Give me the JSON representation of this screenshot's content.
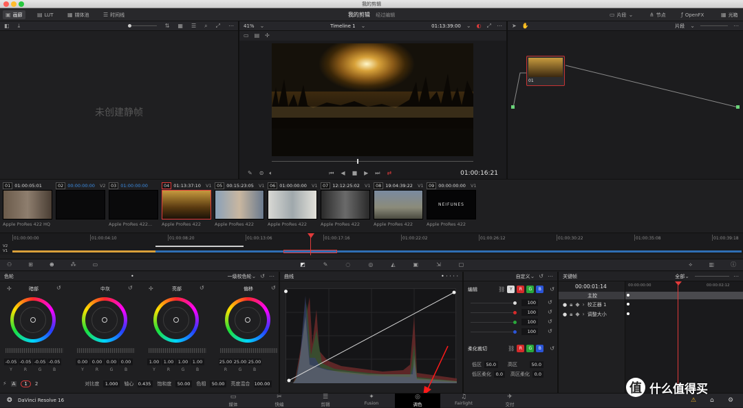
{
  "window": {
    "title": "我的剪辑"
  },
  "toolbar": {
    "gallery": "画廊",
    "lut": "LUT",
    "media_pool": "媒体池",
    "timeline": "时间线",
    "project": "我的剪辑",
    "project_sub": "经过编辑",
    "clips": "片段",
    "nodes": "节点",
    "openfx": "OpenFX",
    "lightbox": "光箱"
  },
  "viewer": {
    "zoom": "41%",
    "timeline_name": "Timeline 1",
    "timecode_top": "01:13:39:00",
    "timecode": "01:00:16:21",
    "clip_mode": "片段"
  },
  "gallery": {
    "empty_text": "未创建静帧"
  },
  "node": {
    "label": "01"
  },
  "clips": [
    {
      "num": "01",
      "tc": "01:00:05:01",
      "blue": false,
      "track": "",
      "fmt": "Apple ProRes 422 HQ",
      "selected": false
    },
    {
      "num": "02",
      "tc": "00:00:00:00",
      "blue": true,
      "track": "V2",
      "fmt": "",
      "selected": false
    },
    {
      "num": "03",
      "tc": "01:00:00:00",
      "blue": true,
      "track": "",
      "fmt": "Apple ProRes 422...",
      "selected": false
    },
    {
      "num": "04",
      "tc": "01:13:37:10",
      "blue": false,
      "track": "V1",
      "fmt": "Apple ProRes 422",
      "selected": true
    },
    {
      "num": "05",
      "tc": "00:15:23:05",
      "blue": false,
      "track": "V1",
      "fmt": "Apple ProRes 422",
      "selected": false
    },
    {
      "num": "06",
      "tc": "01:00:00:00",
      "blue": false,
      "track": "V1",
      "fmt": "Apple ProRes 422",
      "selected": false
    },
    {
      "num": "07",
      "tc": "12:12:25:02",
      "blue": false,
      "track": "V1",
      "fmt": "Apple ProRes 422",
      "selected": false
    },
    {
      "num": "08",
      "tc": "19:04:39:22",
      "blue": false,
      "track": "V1",
      "fmt": "Apple ProRes 422",
      "selected": false
    },
    {
      "num": "09",
      "tc": "00:00:00:00",
      "blue": false,
      "track": "V1",
      "fmt": "Apple ProRes 422",
      "selected": false
    }
  ],
  "clip9_overlay": "NEIFUNES",
  "ruler": [
    "01:00:00:00",
    "01:00:04:10",
    "01:00:08:20",
    "01:00:13:06",
    "01:00:17:16",
    "01:00:22:02",
    "01:00:26:12",
    "01:00:30:22",
    "01:00:35:08",
    "01:00:39:18"
  ],
  "tracks": {
    "v2": "V2",
    "v1": "V1"
  },
  "color_wheels": {
    "panel_title": "色轮",
    "mode": "一级校色轮",
    "wheels": [
      {
        "name": "暗部",
        "values": [
          "-0.05",
          "-0.05",
          "-0.05",
          "-0.05"
        ]
      },
      {
        "name": "中灰",
        "values": [
          "0.00",
          "0.00",
          "0.00",
          "0.00"
        ]
      },
      {
        "name": "亮部",
        "values": [
          "1.00",
          "1.00",
          "1.00",
          "1.00"
        ]
      },
      {
        "name": "偏移",
        "values": [
          "25.00",
          "25.00",
          "25.00"
        ]
      }
    ],
    "ch4": [
      "Y",
      "R",
      "G",
      "B"
    ],
    "ch3": [
      "R",
      "G",
      "B"
    ],
    "page1": "1",
    "page2": "2",
    "contrast_label": "对比度",
    "contrast": "1.000",
    "pivot_label": "轴心",
    "pivot": "0.435",
    "sat_label": "饱和度",
    "sat": "50.00",
    "hue_label": "色相",
    "hue": "50.00",
    "lummix_label": "亮度混合",
    "lummix": "100.00"
  },
  "curves": {
    "panel_title": "曲线",
    "custom": "自定义",
    "edit_label": "编辑",
    "edit_values": [
      "100",
      "100",
      "100",
      "100"
    ],
    "soft_clip_label": "柔化裁切",
    "low_label": "低区",
    "low": "50.0",
    "high_label": "高区",
    "high": "50.0",
    "ls_label": "低区柔化",
    "ls": "0.0",
    "hs_label": "高区柔化",
    "hs": "0.0",
    "btn_y": "Y",
    "btn_r": "R",
    "btn_g": "G",
    "btn_b": "B"
  },
  "keyframes": {
    "panel_title": "关键帧",
    "filter": "全部",
    "tc": "00:00:01:14",
    "ruler_start": "00:00:00:00",
    "ruler_end": "00:00:02:12",
    "master": "主控",
    "corrector": "校正器 1",
    "sizing": "调整大小"
  },
  "footer": {
    "app": "DaVinci Resolve 16",
    "nav": [
      "媒体",
      "快编",
      "剪辑",
      "Fusion",
      "调色",
      "Fairlight",
      "交付"
    ]
  },
  "colors": {
    "accent_red": "#e23b3b",
    "active_blue": "#3d8ee6"
  }
}
